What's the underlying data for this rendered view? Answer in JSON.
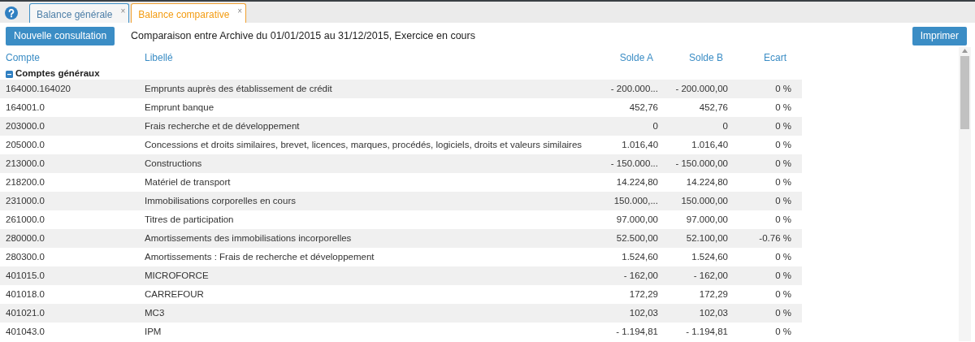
{
  "tabs": [
    {
      "label": "Balance générale",
      "close": "×",
      "selected": false
    },
    {
      "label": "Balance comparative",
      "close": "×",
      "selected": true
    }
  ],
  "toolbar": {
    "new_button": "Nouvelle consultation",
    "title": "Comparaison entre Archive du 01/01/2015 au 31/12/2015, Exercice en cours",
    "print_button": "Imprimer"
  },
  "table": {
    "columns": [
      "Compte",
      "Libellé",
      "Solde A",
      "Solde B",
      "Ecart"
    ],
    "group": {
      "label": "Comptes généraux",
      "expanded": true
    },
    "rows": [
      [
        "164000.164020",
        "Emprunts auprès des établissement de crédit",
        "- 200.000...",
        "- 200.000,00",
        "0 %"
      ],
      [
        "164001.0",
        "Emprunt banque",
        "452,76",
        "452,76",
        "0 %"
      ],
      [
        "203000.0",
        "Frais recherche et de développement",
        "0",
        "0",
        "0 %"
      ],
      [
        "205000.0",
        "Concessions et droits similaires, brevet, licences, marques, procédés, logiciels, droits et valeurs similaires",
        "1.016,40",
        "1.016,40",
        "0 %"
      ],
      [
        "213000.0",
        "Constructions",
        "- 150.000...",
        "- 150.000,00",
        "0 %"
      ],
      [
        "218200.0",
        "Matériel de transport",
        "14.224,80",
        "14.224,80",
        "0 %"
      ],
      [
        "231000.0",
        "Immobilisations corporelles en cours",
        "150.000,...",
        "150.000,00",
        "0 %"
      ],
      [
        "261000.0",
        "Titres de participation",
        "97.000,00",
        "97.000,00",
        "0 %"
      ],
      [
        "280000.0",
        "Amortissements des immobilisations incorporelles",
        "52.500,00",
        "52.100,00",
        "-0.76 %"
      ],
      [
        "280300.0",
        "Amortissements : Frais de recherche et développement",
        "1.524,60",
        "1.524,60",
        "0 %"
      ],
      [
        "401015.0",
        "MICROFORCE",
        "- 162,00",
        "- 162,00",
        "0 %"
      ],
      [
        "401018.0",
        "CARREFOUR",
        "172,29",
        "172,29",
        "0 %"
      ],
      [
        "401021.0",
        "MC3",
        "102,03",
        "102,03",
        "0 %"
      ],
      [
        "401043.0",
        "IPM",
        "- 1.194,81",
        "- 1.194,81",
        "0 %"
      ]
    ]
  }
}
